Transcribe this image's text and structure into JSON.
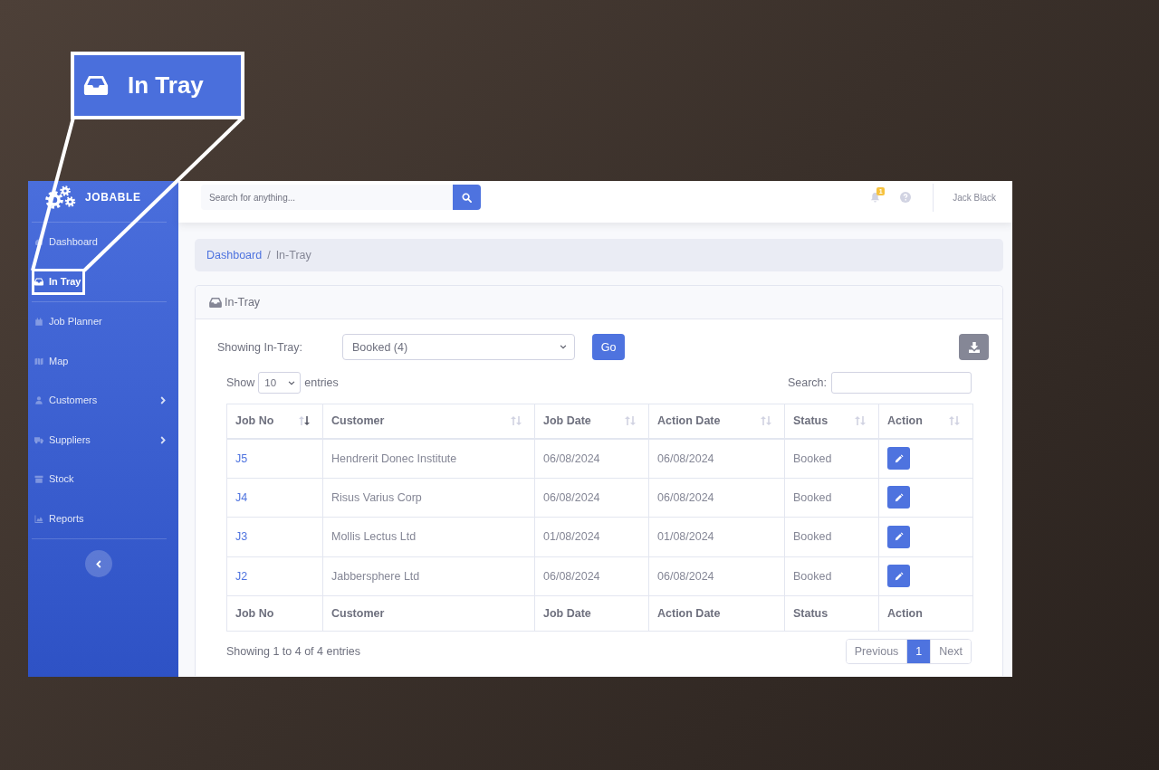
{
  "callout": {
    "label": "In Tray"
  },
  "sidebar": {
    "brand": "JOBABLE",
    "sections": [
      {
        "items": [
          {
            "label": "Dashboard",
            "selected": false,
            "has_submenu": false
          },
          {
            "label": "In Tray",
            "selected": true,
            "has_submenu": false
          }
        ]
      },
      {
        "items": [
          {
            "label": "Job Planner",
            "selected": false,
            "has_submenu": false
          },
          {
            "label": "Map",
            "selected": false,
            "has_submenu": false
          },
          {
            "label": "Customers",
            "selected": false,
            "has_submenu": true
          },
          {
            "label": "Suppliers",
            "selected": false,
            "has_submenu": true
          },
          {
            "label": "Stock",
            "selected": false,
            "has_submenu": false
          },
          {
            "label": "Reports",
            "selected": false,
            "has_submenu": false
          }
        ]
      }
    ]
  },
  "topbar": {
    "search": {
      "placeholder": "Search for anything..."
    },
    "notifications": {
      "count": "1"
    },
    "user": "Jack Black"
  },
  "breadcrumb": {
    "separator": "/",
    "items": [
      {
        "label": "Dashboard",
        "link": true
      },
      {
        "label": "In-Tray",
        "link": false
      }
    ]
  },
  "card": {
    "title": "In-Tray",
    "filter": {
      "label": "Showing In-Tray:",
      "value": "Booked (4)"
    },
    "go_button": "Go",
    "length": {
      "prefix": "Show",
      "value": "10",
      "suffix": "entries"
    },
    "search": {
      "label": "Search:"
    },
    "table": {
      "columns": [
        {
          "label": "Job No",
          "kind": "link",
          "sorted_descending": true
        },
        {
          "label": "Customer",
          "kind": "text",
          "sorted_descending": false
        },
        {
          "label": "Job Date",
          "kind": "text",
          "sorted_descending": false
        },
        {
          "label": "Action Date",
          "kind": "text",
          "sorted_descending": false
        },
        {
          "label": "Status",
          "kind": "text",
          "sorted_descending": false
        },
        {
          "label": "Action",
          "kind": "action",
          "sorted_descending": false
        }
      ],
      "rows": [
        [
          "J5",
          "Hendrerit Donec Institute",
          "06/08/2024",
          "06/08/2024",
          "Booked"
        ],
        [
          "J4",
          "Risus Varius Corp",
          "06/08/2024",
          "06/08/2024",
          "Booked"
        ],
        [
          "J3",
          "Mollis Lectus Ltd",
          "01/08/2024",
          "01/08/2024",
          "Booked"
        ],
        [
          "J2",
          "Jabbersphere Ltd",
          "06/08/2024",
          "06/08/2024",
          "Booked"
        ]
      ],
      "footer": [
        "Job No",
        "Customer",
        "Job Date",
        "Action Date",
        "Status",
        "Action"
      ]
    },
    "info": "Showing 1 to 4 of 4 entries",
    "pagination": [
      {
        "label": "Previous",
        "selected": false
      },
      {
        "label": "1",
        "selected": true
      },
      {
        "label": "Next",
        "selected": false
      }
    ]
  }
}
